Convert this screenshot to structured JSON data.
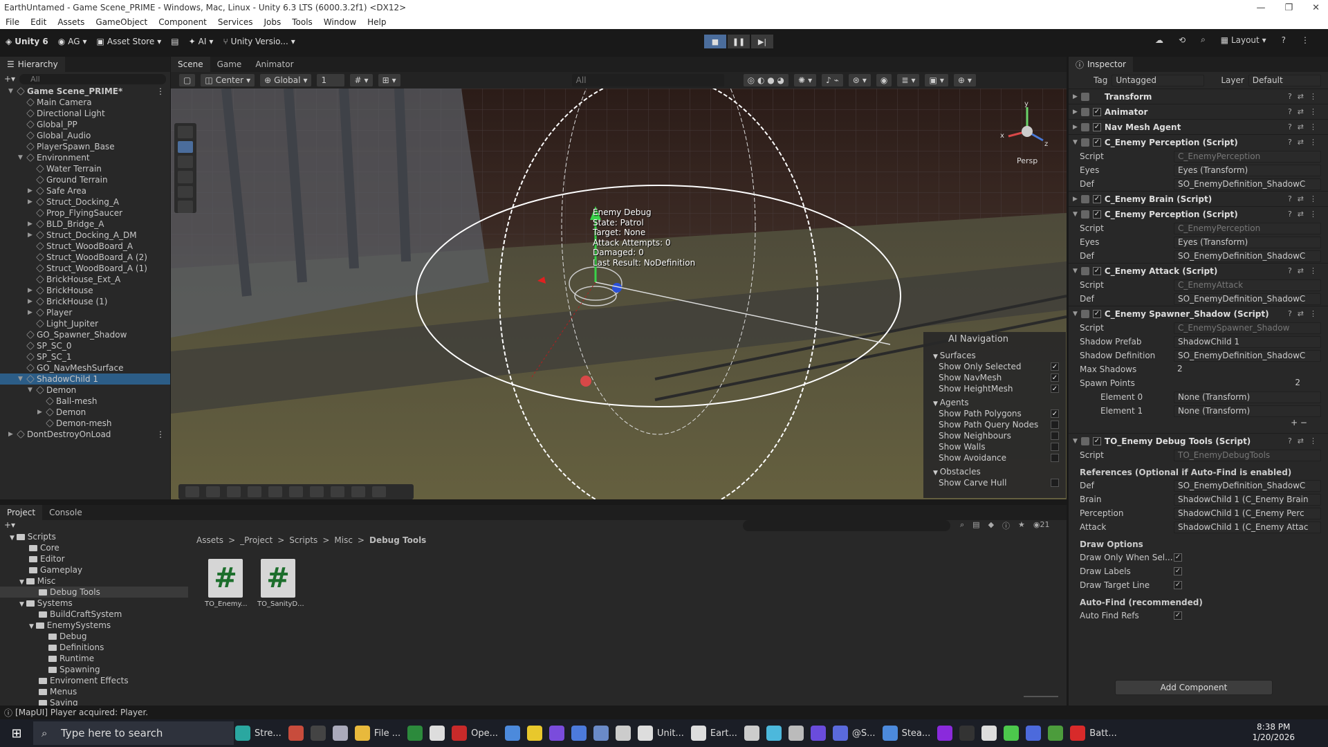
{
  "window": {
    "title": "EarthUntamed - Game Scene_PRIME - Windows, Mac, Linux - Unity 6.3 LTS (6000.3.2f1) <DX12>"
  },
  "menu": [
    "File",
    "Edit",
    "Assets",
    "GameObject",
    "Component",
    "Services",
    "Jobs",
    "Tools",
    "Window",
    "Help"
  ],
  "toolbar": {
    "unity": "Unity 6",
    "account": "AG",
    "asset_store": "Asset Store",
    "ai": "AI",
    "version": "Unity Versio...",
    "layout": "Layout"
  },
  "hierarchy": {
    "tab": "Hierarchy",
    "search": "All",
    "items": [
      {
        "label": "Game Scene_PRIME*",
        "depth": 0,
        "arrow": "▼",
        "bold": true
      },
      {
        "label": "Main Camera",
        "depth": 1
      },
      {
        "label": "Directional Light",
        "depth": 1
      },
      {
        "label": "Global_PP",
        "depth": 1
      },
      {
        "label": "Global_Audio",
        "depth": 1
      },
      {
        "label": "PlayerSpawn_Base",
        "depth": 1
      },
      {
        "label": "Environment",
        "depth": 1,
        "arrow": "▼"
      },
      {
        "label": "Water Terrain",
        "depth": 2
      },
      {
        "label": "Ground Terrain",
        "depth": 2
      },
      {
        "label": "Safe Area",
        "depth": 2,
        "arrow": "▶"
      },
      {
        "label": "Struct_Docking_A",
        "depth": 2,
        "arrow": "▶"
      },
      {
        "label": "Prop_FlyingSaucer",
        "depth": 2
      },
      {
        "label": "BLD_Bridge_A",
        "depth": 2,
        "arrow": "▶"
      },
      {
        "label": "Struct_Docking_A_DM",
        "depth": 2,
        "arrow": "▶"
      },
      {
        "label": "Struct_WoodBoard_A",
        "depth": 2
      },
      {
        "label": "Struct_WoodBoard_A (2)",
        "depth": 2
      },
      {
        "label": "Struct_WoodBoard_A (1)",
        "depth": 2
      },
      {
        "label": "BrickHouse_Ext_A",
        "depth": 2
      },
      {
        "label": "BrickHouse",
        "depth": 2,
        "arrow": "▶"
      },
      {
        "label": "BrickHouse (1)",
        "depth": 2,
        "arrow": "▶"
      },
      {
        "label": "Player",
        "depth": 2,
        "arrow": "▶"
      },
      {
        "label": "Light_Jupiter",
        "depth": 2
      },
      {
        "label": "GO_Spawner_Shadow",
        "depth": 1
      },
      {
        "label": "SP_SC_0",
        "depth": 1
      },
      {
        "label": "SP_SC_1",
        "depth": 1
      },
      {
        "label": "GO_NavMeshSurface",
        "depth": 1
      },
      {
        "label": "ShadowChild 1",
        "depth": 1,
        "arrow": "▼",
        "sel": true
      },
      {
        "label": "Demon",
        "depth": 2,
        "arrow": "▼"
      },
      {
        "label": "Ball-mesh",
        "depth": 3
      },
      {
        "label": "Demon",
        "depth": 3,
        "arrow": "▶"
      },
      {
        "label": "Demon-mesh",
        "depth": 3
      },
      {
        "label": "DontDestroyOnLoad",
        "depth": 0,
        "arrow": "▶"
      }
    ]
  },
  "scene": {
    "tabs": [
      "Scene",
      "Game",
      "Animator"
    ],
    "pivot": "Center",
    "space": "Global",
    "grid_val": "1",
    "search": "All",
    "persp": "Persp"
  },
  "debug_overlay": {
    "lines": [
      "Enemy Debug",
      "State: Patrol",
      "Target: None",
      "Attack Attempts: 0",
      "Damaged: 0",
      "Last Result: NoDefinition"
    ]
  },
  "ai_nav": {
    "title": "AI Navigation",
    "rows": [
      {
        "label": "Surfaces",
        "hdr": true
      },
      {
        "label": "Show Only Selected",
        "checked": true
      },
      {
        "label": "Show NavMesh",
        "checked": true
      },
      {
        "label": "Show HeightMesh",
        "checked": true
      },
      {
        "label": "Agents",
        "hdr": true
      },
      {
        "label": "Show Path Polygons",
        "checked": true
      },
      {
        "label": "Show Path Query Nodes",
        "checked": false
      },
      {
        "label": "Show Neighbours",
        "checked": false
      },
      {
        "label": "Show Walls",
        "checked": false
      },
      {
        "label": "Show Avoidance",
        "checked": false
      },
      {
        "label": "Obstacles",
        "hdr": true
      },
      {
        "label": "Show Carve Hull",
        "checked": false
      }
    ]
  },
  "inspector": {
    "tab": "Inspector",
    "tag_label": "Tag",
    "tag": "Untagged",
    "layer_label": "Layer",
    "layer": "Default",
    "blocks": [
      {
        "t": "comp",
        "label": "Transform",
        "check": false
      },
      {
        "t": "comp",
        "label": "Animator",
        "check": true
      },
      {
        "t": "comp",
        "label": "Nav Mesh Agent",
        "check": true
      },
      {
        "t": "comp",
        "label": "C_Enemy Perception (Script)",
        "check": true,
        "open": true
      },
      {
        "t": "prop",
        "label": "Script",
        "value": "C_EnemyPerception",
        "dim": true
      },
      {
        "t": "prop",
        "label": "Eyes",
        "value": "Eyes (Transform)"
      },
      {
        "t": "prop",
        "label": "Def",
        "value": "SO_EnemyDefinition_ShadowC"
      },
      {
        "t": "comp",
        "label": "C_Enemy Brain (Script)",
        "check": true
      },
      {
        "t": "comp",
        "label": "C_Enemy Perception (Script)",
        "check": true,
        "open": true
      },
      {
        "t": "prop",
        "label": "Script",
        "value": "C_EnemyPerception",
        "dim": true
      },
      {
        "t": "prop",
        "label": "Eyes",
        "value": "Eyes (Transform)"
      },
      {
        "t": "prop",
        "label": "Def",
        "value": "SO_EnemyDefinition_ShadowC"
      },
      {
        "t": "comp",
        "label": "C_Enemy Attack (Script)",
        "check": true,
        "open": true
      },
      {
        "t": "prop",
        "label": "Script",
        "value": "C_EnemyAttack",
        "dim": true
      },
      {
        "t": "prop",
        "label": "Def",
        "value": "SO_EnemyDefinition_ShadowC"
      },
      {
        "t": "comp",
        "label": "C_Enemy Spawner_Shadow (Script)",
        "check": true,
        "open": true
      },
      {
        "t": "prop",
        "label": "Script",
        "value": "C_EnemySpawner_Shadow",
        "dim": true
      },
      {
        "t": "prop",
        "label": "Shadow Prefab",
        "value": "ShadowChild 1"
      },
      {
        "t": "prop",
        "label": "Shadow Definition",
        "value": "SO_EnemyDefinition_ShadowC"
      },
      {
        "t": "prop",
        "label": "Max Shadows",
        "value": "2",
        "plain": true
      },
      {
        "t": "prop",
        "label": "Spawn Points",
        "value": "2",
        "plain": true
      },
      {
        "t": "prop",
        "label": "Element 0",
        "value": "None (Transform)",
        "indent": true
      },
      {
        "t": "prop",
        "label": "Element 1",
        "value": "None (Transform)",
        "indent": true
      },
      {
        "t": "gap",
        "label": "+ −"
      },
      {
        "t": "comp",
        "label": "TO_Enemy Debug Tools (Script)",
        "check": true,
        "open": true
      },
      {
        "t": "prop",
        "label": "Script",
        "value": "TO_EnemyDebugTools",
        "dim": true
      },
      {
        "t": "sec",
        "label": "References (Optional if Auto-Find is enabled)"
      },
      {
        "t": "prop",
        "label": "Def",
        "value": "SO_EnemyDefinition_ShadowC"
      },
      {
        "t": "prop",
        "label": "Brain",
        "value": "ShadowChild 1 (C_Enemy Brain"
      },
      {
        "t": "prop",
        "label": "Perception",
        "value": "ShadowChild 1 (C_Enemy Perc"
      },
      {
        "t": "prop",
        "label": "Attack",
        "value": "ShadowChild 1 (C_Enemy Attac"
      },
      {
        "t": "sec",
        "label": "Draw Options"
      },
      {
        "t": "chk",
        "label": "Draw Only When Sel..."
      },
      {
        "t": "chk",
        "label": "Draw Labels"
      },
      {
        "t": "chk",
        "label": "Draw Target Line"
      },
      {
        "t": "sec",
        "label": "Auto-Find (recommended)"
      },
      {
        "t": "chk",
        "label": "Auto Find Refs"
      }
    ],
    "add_component": "Add Component"
  },
  "project": {
    "tabs": [
      "Project",
      "Console"
    ],
    "count": "21",
    "tree": [
      {
        "label": "Scripts",
        "depth": 2,
        "arrow": "▼"
      },
      {
        "label": "Core",
        "depth": 3
      },
      {
        "label": "Editor",
        "depth": 3
      },
      {
        "label": "Gameplay",
        "depth": 3
      },
      {
        "label": "Misc",
        "depth": 3,
        "arrow": "▼"
      },
      {
        "label": "Debug Tools",
        "depth": 4,
        "sel": true
      },
      {
        "label": "Systems",
        "depth": 3,
        "arrow": "▼"
      },
      {
        "label": "BuildCraftSystem",
        "depth": 4
      },
      {
        "label": "EnemySystems",
        "depth": 4,
        "arrow": "▼"
      },
      {
        "label": "Debug",
        "depth": 5
      },
      {
        "label": "Definitions",
        "depth": 5
      },
      {
        "label": "Runtime",
        "depth": 5
      },
      {
        "label": "Spawning",
        "depth": 5
      },
      {
        "label": "Enviroment Effects",
        "depth": 4
      },
      {
        "label": "Menus",
        "depth": 4
      },
      {
        "label": "Saving",
        "depth": 4
      }
    ],
    "breadcrumb": [
      "Assets",
      "_Project",
      "Scripts",
      "Misc",
      "Debug Tools"
    ],
    "assets": [
      {
        "label": "TO_Enemy..."
      },
      {
        "label": "TO_SanityD..."
      }
    ]
  },
  "status": {
    "text": "[MapUI] Player acquired: Player."
  },
  "taskbar": {
    "search": "Type here to search",
    "apps": [
      "Stre...",
      "",
      "",
      "",
      "File ...",
      "",
      "",
      "Ope...",
      "",
      "",
      "",
      "",
      "",
      "",
      "Unit...",
      "Eart...",
      "",
      "",
      "",
      "",
      "@S...",
      "Stea...",
      "",
      "",
      "",
      "",
      "",
      "",
      "Batt..."
    ],
    "time": "8:38 PM",
    "date": "1/20/2026"
  }
}
